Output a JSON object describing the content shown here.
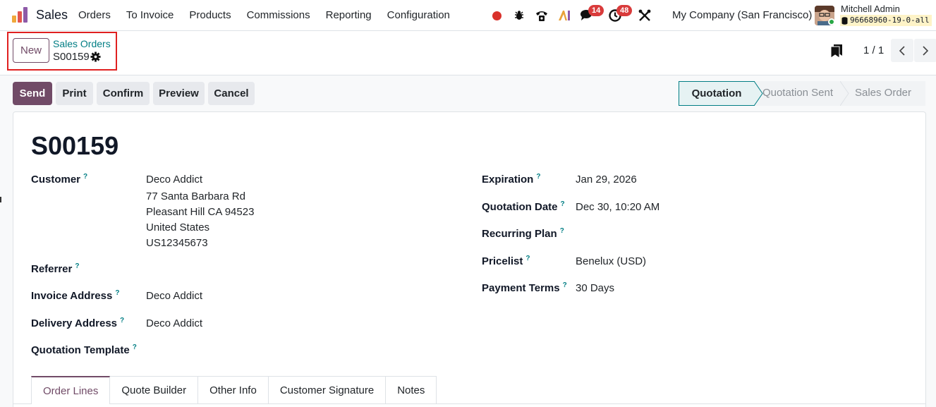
{
  "navbar": {
    "app_name": "Sales",
    "menu": [
      "Orders",
      "To Invoice",
      "Products",
      "Commissions",
      "Reporting",
      "Configuration"
    ],
    "messages_count": "14",
    "activities_count": "48",
    "company": "My Company (San Francisco)",
    "user_name": "Mitchell Admin",
    "database": "96668960-19-0-all"
  },
  "control_panel": {
    "new_label": "New",
    "breadcrumb_parent": "Sales Orders",
    "breadcrumb_current": "S00159",
    "pager": "1 / 1"
  },
  "actions": {
    "send": "Send",
    "print": "Print",
    "confirm": "Confirm",
    "preview": "Preview",
    "cancel": "Cancel"
  },
  "status_stages": [
    "Quotation",
    "Quotation Sent",
    "Sales Order"
  ],
  "status_active": "Quotation",
  "form": {
    "title": "S00159",
    "left": {
      "customer_label": "Customer",
      "customer_name": "Deco Addict",
      "customer_street": "77 Santa Barbara Rd",
      "customer_city": "Pleasant Hill CA 94523",
      "customer_country": "United States",
      "customer_vat": "US12345673",
      "referrer_label": "Referrer",
      "invoice_address_label": "Invoice Address",
      "invoice_address": "Deco Addict",
      "delivery_address_label": "Delivery Address",
      "delivery_address": "Deco Addict",
      "quotation_template_label": "Quotation Template"
    },
    "right": {
      "expiration_label": "Expiration",
      "expiration": "Jan 29, 2026",
      "quotation_date_label": "Quotation Date",
      "quotation_date": "Dec 30, 10:20 AM",
      "recurring_plan_label": "Recurring Plan",
      "pricelist_label": "Pricelist",
      "pricelist": "Benelux (USD)",
      "payment_terms_label": "Payment Terms",
      "payment_terms": "30 Days"
    },
    "help_marker": "?"
  },
  "tabs": [
    "Order Lines",
    "Quote Builder",
    "Other Info",
    "Customer Signature",
    "Notes"
  ],
  "colors": {
    "brand": "#714b67",
    "accent": "#017e84",
    "badge": "#d93b3b",
    "highlight": "#e02020"
  }
}
